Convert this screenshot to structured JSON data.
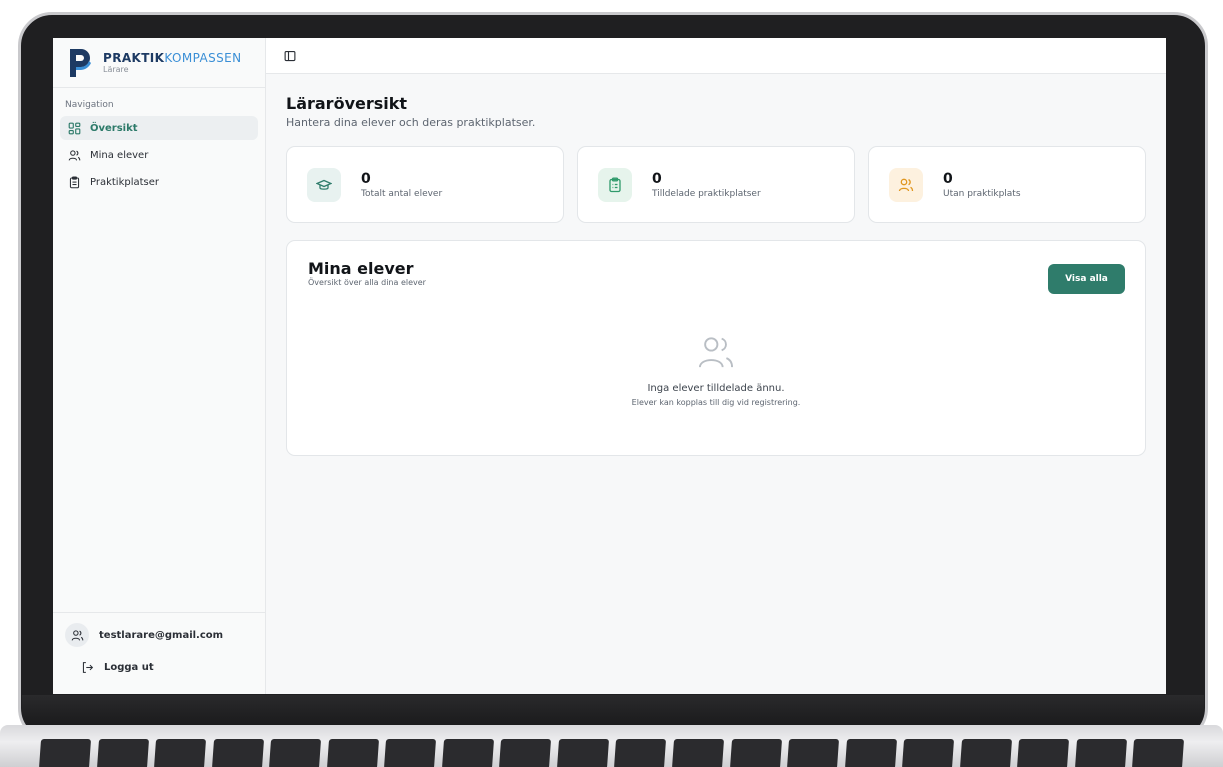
{
  "brand": {
    "name_bold": "PRAKTIK",
    "name_light": "KOMPASSEN",
    "role": "Lärare",
    "primary_color": "#1d3a63",
    "accent_color": "#3b8fd6"
  },
  "sidebar": {
    "section_label": "Navigation",
    "items": [
      {
        "label": "Översikt",
        "icon": "grid-icon",
        "active": true
      },
      {
        "label": "Mina elever",
        "icon": "users-icon",
        "active": false
      },
      {
        "label": "Praktikplatser",
        "icon": "clipboard-icon",
        "active": false
      }
    ],
    "user_email": "testlarare@gmail.com",
    "logout_label": "Logga ut"
  },
  "header": {
    "toggle_icon": "sidebar-toggle-icon"
  },
  "page": {
    "title": "Läraröversikt",
    "subtitle": "Hantera dina elever och deras praktikplatser."
  },
  "stats": [
    {
      "value": "0",
      "label": "Totalt antal elever",
      "icon": "graduation-cap-icon",
      "color": "#2f7c6b"
    },
    {
      "value": "0",
      "label": "Tilldelade praktikplatser",
      "icon": "clipboard-list-icon",
      "color": "#2f9a6b"
    },
    {
      "value": "0",
      "label": "Utan praktikplats",
      "icon": "users-icon",
      "color": "#e0961f"
    }
  ],
  "students": {
    "title": "Mina elever",
    "subtitle": "Översikt över alla dina elever",
    "view_all_label": "Visa alla",
    "empty_title": "Inga elever tilldelade ännu.",
    "empty_subtitle": "Elever kan kopplas till dig vid registrering.",
    "button_color": "#2f7c6b"
  }
}
